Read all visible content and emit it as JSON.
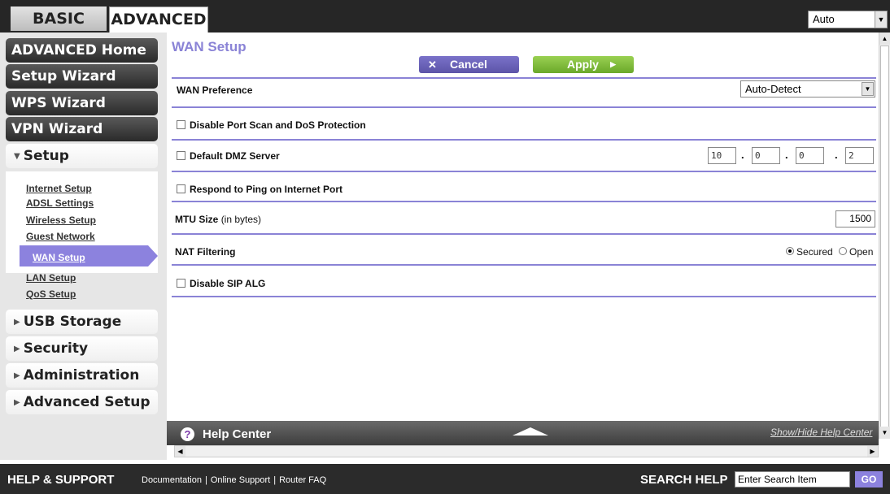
{
  "tabs": {
    "basic": "BASIC",
    "advanced": "ADVANCED"
  },
  "language": {
    "selected": "Auto"
  },
  "sidebar": {
    "main_items": [
      "ADVANCED Home",
      "Setup Wizard",
      "WPS Wizard",
      "VPN Wizard"
    ],
    "setup": {
      "label": "Setup",
      "items": [
        "Internet Setup",
        "ADSL Settings",
        "Wireless Setup",
        "Guest Network",
        "WAN Setup",
        "LAN Setup",
        "QoS Setup"
      ],
      "active": "WAN Setup"
    },
    "sections": [
      "USB Storage",
      "Security",
      "Administration",
      "Advanced Setup"
    ]
  },
  "page": {
    "title": "WAN Setup",
    "cancel_label": "Cancel",
    "apply_label": "Apply",
    "wan_preference_label": "WAN Preference",
    "wan_preference_value": "Auto-Detect",
    "disable_port_scan_label": "Disable Port Scan and DoS Protection",
    "dmz_label": "Default DMZ Server",
    "dmz_ip": [
      "10",
      "0",
      "0",
      "2"
    ],
    "ping_label": "Respond to Ping on Internet Port",
    "mtu_label": "MTU Size",
    "mtu_unit": "(in bytes)",
    "mtu_value": "1500",
    "nat_label": "NAT Filtering",
    "nat_options": [
      "Secured",
      "Open"
    ],
    "nat_selected": "Secured",
    "sip_label": "Disable SIP ALG"
  },
  "help": {
    "title": "Help Center",
    "toggle": "Show/Hide Help Center"
  },
  "footer": {
    "title": "HELP & SUPPORT",
    "links": [
      "Documentation",
      "Online Support",
      "Router FAQ"
    ],
    "search_label": "SEARCH HELP",
    "search_value": "Enter Search Item",
    "go_label": "GO"
  },
  "colors": {
    "accent": "#8c82de",
    "apply": "#7cbf3a",
    "dark": "#2b2b2b"
  }
}
